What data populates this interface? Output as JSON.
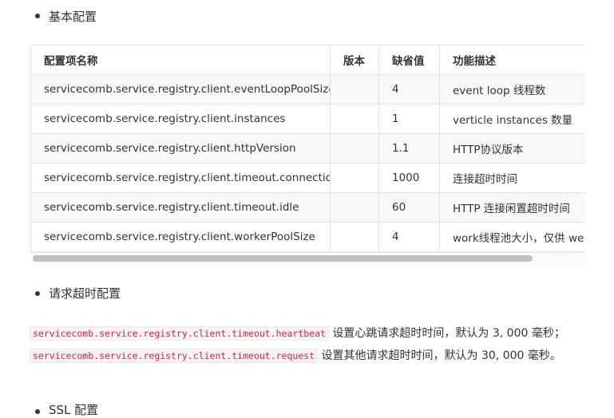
{
  "section1": {
    "title": "基本配置"
  },
  "table": {
    "headers": [
      "配置项名称",
      "版本",
      "缺省值",
      "功能描述"
    ],
    "rows": [
      [
        "servicecomb.service.registry.client.eventLoopPoolSize",
        "",
        "4",
        "event loop 线程数"
      ],
      [
        "servicecomb.service.registry.client.instances",
        "",
        "1",
        "verticle instances 数量"
      ],
      [
        "servicecomb.service.registry.client.httpVersion",
        "",
        "1.1",
        "HTTP协议版本"
      ],
      [
        "servicecomb.service.registry.client.timeout.connection",
        "",
        "1000",
        "连接超时时间"
      ],
      [
        "servicecomb.service.registry.client.timeout.idle",
        "",
        "60",
        "HTTP 连接闲置超时时间"
      ],
      [
        "servicecomb.service.registry.client.workerPoolSize",
        "",
        "4",
        "work线程池大小，仅供 we"
      ]
    ]
  },
  "section2": {
    "title": "请求超时配置"
  },
  "paragraph": {
    "code1": "servicecomb.service.registry.client.timeout.heartbeat",
    "text1": " 设置心跳请求超时时间，默认为 3, 000 毫秒；",
    "code2": "servicecomb.service.registry.client.timeout.request",
    "text2": " 设置其他请求超时时间，默认为 30, 000 毫秒。"
  },
  "section3": {
    "title": "SSL 配置"
  }
}
